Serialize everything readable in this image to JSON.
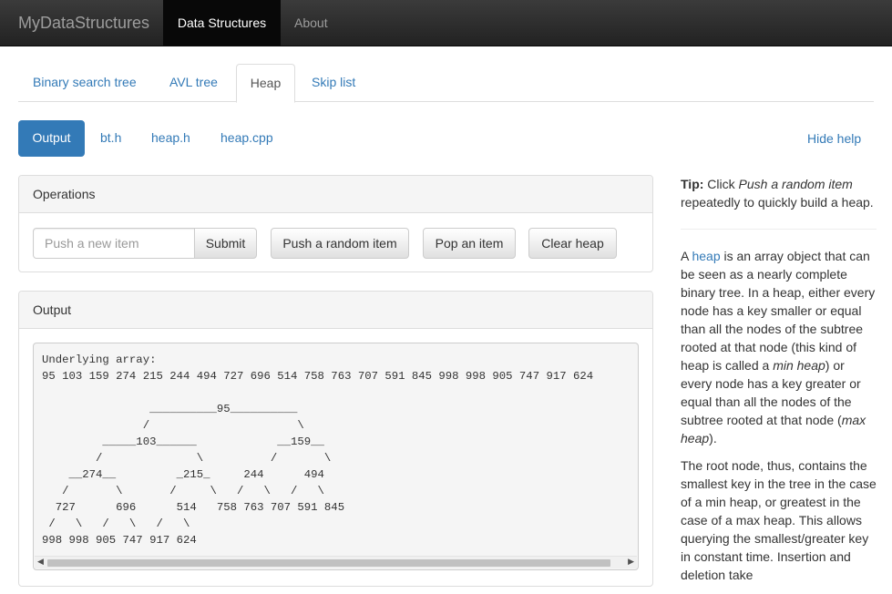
{
  "navbar": {
    "brand": "MyDataStructures",
    "items": [
      {
        "label": "Data Structures",
        "active": true
      },
      {
        "label": "About",
        "active": false
      }
    ]
  },
  "tabs": [
    {
      "label": "Binary search tree"
    },
    {
      "label": "AVL tree"
    },
    {
      "label": "Heap",
      "active": true
    },
    {
      "label": "Skip list"
    }
  ],
  "pills": [
    {
      "label": "Output",
      "active": true
    },
    {
      "label": "bt.h"
    },
    {
      "label": "heap.h"
    },
    {
      "label": "heap.cpp"
    }
  ],
  "hide_help": "Hide help",
  "operations": {
    "heading": "Operations",
    "input_placeholder": "Push a new item",
    "input_value": "",
    "submit_label": "Submit",
    "push_random_label": "Push a random item",
    "pop_label": "Pop an item",
    "clear_label": "Clear heap"
  },
  "output": {
    "heading": "Output",
    "lines": [
      "Underlying array:",
      "95 103 159 274 215 244 494 727 696 514 758 763 707 591 845 998 998 905 747 917 624",
      "",
      "                __________95__________",
      "               /                      \\",
      "         _____103______            __159__",
      "        /              \\          /       \\",
      "    __274__         _215_     244      494",
      "   /       \\       /     \\   /   \\   /   \\",
      "  727      696      514   758 763 707 591 845",
      " /   \\   /   \\   /   \\",
      "998 998 905 747 917 624"
    ],
    "scrollbar": {
      "left_arrow": "◀",
      "right_arrow": "▶"
    }
  },
  "help": {
    "tip_label": "Tip:",
    "tip_pre": " Click ",
    "tip_em": "Push a random item",
    "tip_post": " repeatedly to quickly build a heap.",
    "p1_a": "A ",
    "p1_link": "heap",
    "p1_b": " is an array object that can be seen as a nearly complete binary tree. In a heap, either every node has a key smaller or equal than all the nodes of the subtree rooted at that node (this kind of heap is called a ",
    "p1_em1": "min heap",
    "p1_c": ") or every node has a key greater or equal than all the nodes of the subtree rooted at that node (",
    "p1_em2": "max heap",
    "p1_d": ").",
    "p2": "The root node, thus, contains the smallest key in the tree in the case of a min heap, or greatest in the case of a max heap. This allows querying the smallest/greater key in constant time. Insertion and deletion take"
  }
}
